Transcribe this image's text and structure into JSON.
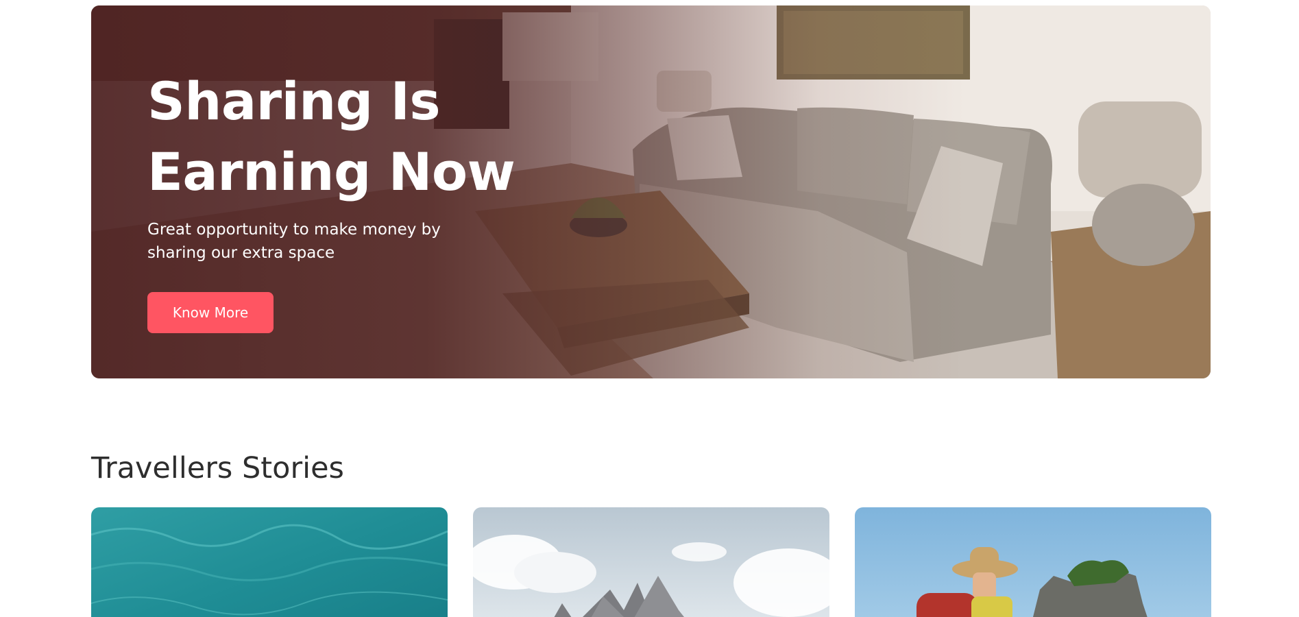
{
  "hero": {
    "title_line1": "Sharing Is",
    "title_line2": "Earning Now",
    "subtitle": "Great opportunity to make money by sharing our extra space",
    "button_label": "Know More",
    "accent_color": "#ff5562",
    "image": "living-room-photo"
  },
  "stories": {
    "section_title": "Travellers Stories",
    "cards": [
      {
        "image": "ocean-water-photo"
      },
      {
        "image": "mountain-peaks-photo"
      },
      {
        "image": "hiker-with-backpack-photo"
      }
    ]
  }
}
